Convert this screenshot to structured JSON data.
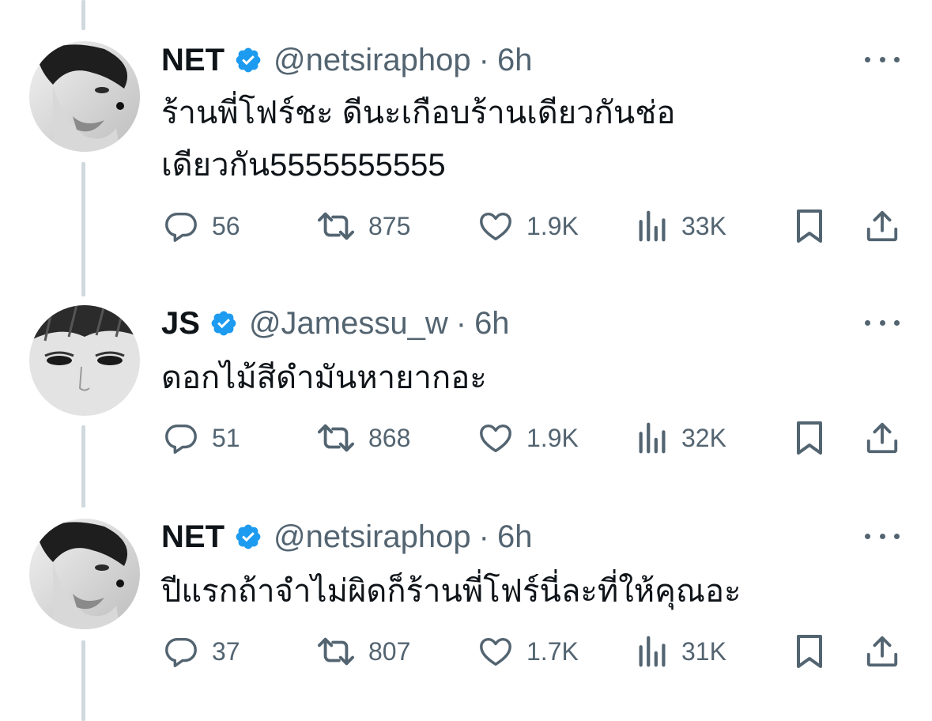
{
  "tweets": [
    {
      "display_name": "NET",
      "handle": "@netsiraphop",
      "separator": "·",
      "time": "6h",
      "text_lines": [
        "ร้านพี่โฟร์ชะ ดีนะเกือบร้านเดียวกันช่อ",
        "เดียวกัน5555555555"
      ],
      "replies": "56",
      "reposts": "875",
      "likes": "1.9K",
      "views": "33K",
      "verified": true
    },
    {
      "display_name": "JS",
      "handle": "@Jamessu_w",
      "separator": "·",
      "time": "6h",
      "text_lines": [
        "ดอกไม้สีดำมันหายากอะ"
      ],
      "replies": "51",
      "reposts": "868",
      "likes": "1.9K",
      "views": "32K",
      "verified": true
    },
    {
      "display_name": "NET",
      "handle": "@netsiraphop",
      "separator": "·",
      "time": "6h",
      "text_lines": [
        "ปีแรกถ้าจำไม่ผิดก็ร้านพี่โฟร์นี่ละที่ให้คุณอะ"
      ],
      "replies": "37",
      "reposts": "807",
      "likes": "1.7K",
      "views": "31K",
      "verified": true
    }
  ],
  "colors": {
    "text": "#0f1419",
    "secondary": "#536471",
    "verified_blue": "#1d9bf0",
    "thread_line": "#cfd9de"
  },
  "icons": [
    "verified-badge-icon",
    "more-icon",
    "reply-icon",
    "repost-icon",
    "like-icon",
    "views-icon",
    "bookmark-icon",
    "share-icon"
  ]
}
